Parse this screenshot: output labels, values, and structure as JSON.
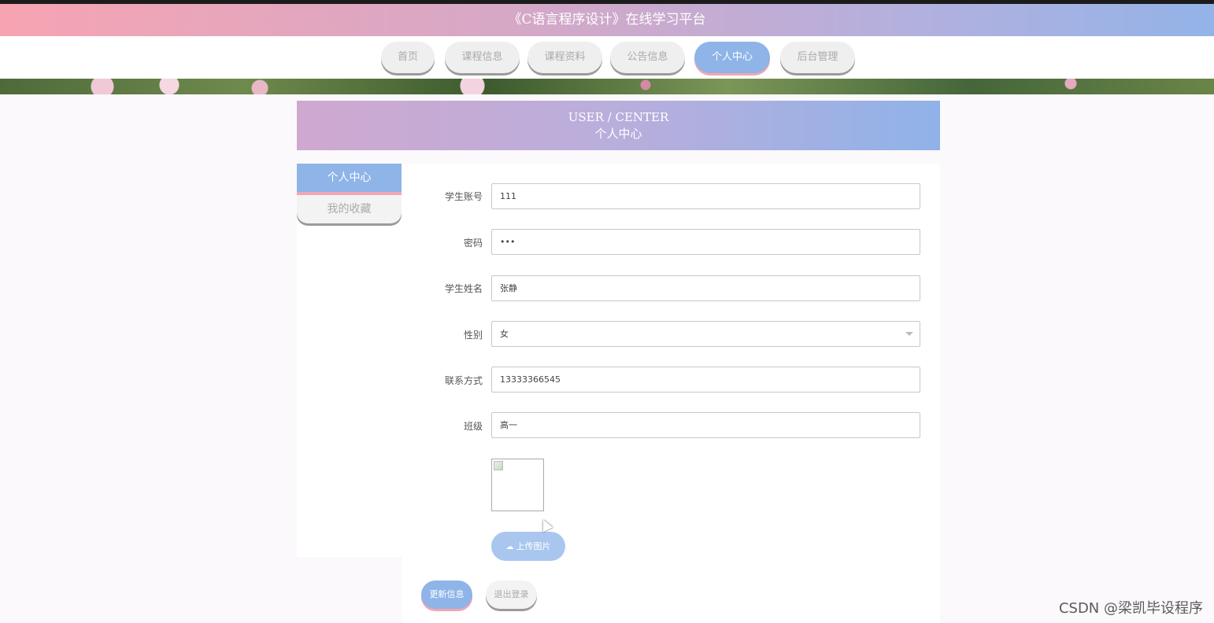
{
  "header": {
    "title": "《C语言程序设计》在线学习平台"
  },
  "nav": {
    "items": [
      {
        "label": "首页"
      },
      {
        "label": "课程信息"
      },
      {
        "label": "课程资料"
      },
      {
        "label": "公告信息"
      },
      {
        "label": "个人中心",
        "active": true
      },
      {
        "label": "后台管理"
      }
    ]
  },
  "section": {
    "title_en": "USER / CENTER",
    "title_cn": "个人中心"
  },
  "sidebar": {
    "items": [
      {
        "label": "个人中心",
        "active": true
      },
      {
        "label": "我的收藏"
      }
    ]
  },
  "form": {
    "fields": [
      {
        "label": "学生账号",
        "value": "111"
      },
      {
        "label": "密码",
        "value": "•••"
      },
      {
        "label": "学生姓名",
        "value": "张静"
      },
      {
        "label": "性别",
        "value": "女"
      },
      {
        "label": "联系方式",
        "value": "13333366545"
      },
      {
        "label": "班级",
        "value": "高一"
      }
    ],
    "upload_label": "上传图片",
    "update_label": "更新信息",
    "logout_label": "退出登录"
  },
  "watermark": "CSDN @梁凯毕设程序",
  "colors": {
    "accent": "#8eb4e8",
    "pink": "#f2a6b4"
  }
}
